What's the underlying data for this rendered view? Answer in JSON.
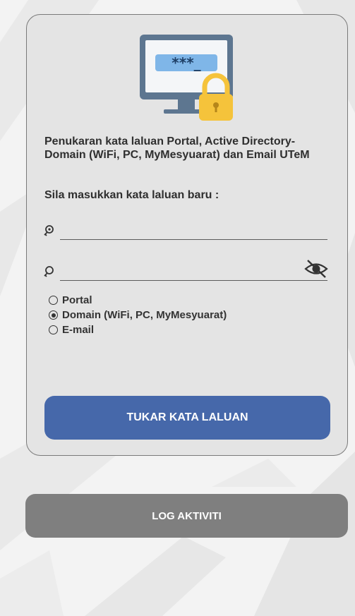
{
  "card": {
    "heading": "Penukaran kata laluan Portal, Active Directory-Domain (WiFi, PC, MyMesyuarat) dan Email UTeM",
    "subheading": "Sila masukkan kata laluan baru :",
    "illustration": {
      "screen_text": "***_",
      "icons": [
        "monitor-icon",
        "padlock-icon"
      ]
    },
    "password_field": {
      "icon": "key-icon",
      "value": "",
      "placeholder": ""
    },
    "confirm_field": {
      "icon": "key-icon",
      "toggle_icon": "eye-slash-icon",
      "value": "",
      "placeholder": ""
    },
    "options": [
      {
        "label": "Portal",
        "selected": false
      },
      {
        "label": "Domain (WiFi, PC, MyMesyuarat)",
        "selected": true
      },
      {
        "label": "E-mail",
        "selected": false
      }
    ],
    "submit_label": "TUKAR KATA LALUAN"
  },
  "log_button_label": "LOG AKTIVITI",
  "colors": {
    "primary_button": "#4668aa",
    "secondary_button": "#7f7f7f",
    "card_background": "#e4e4e4",
    "monitor_screen": "#7fb6e8",
    "padlock": "#f5c33b"
  }
}
